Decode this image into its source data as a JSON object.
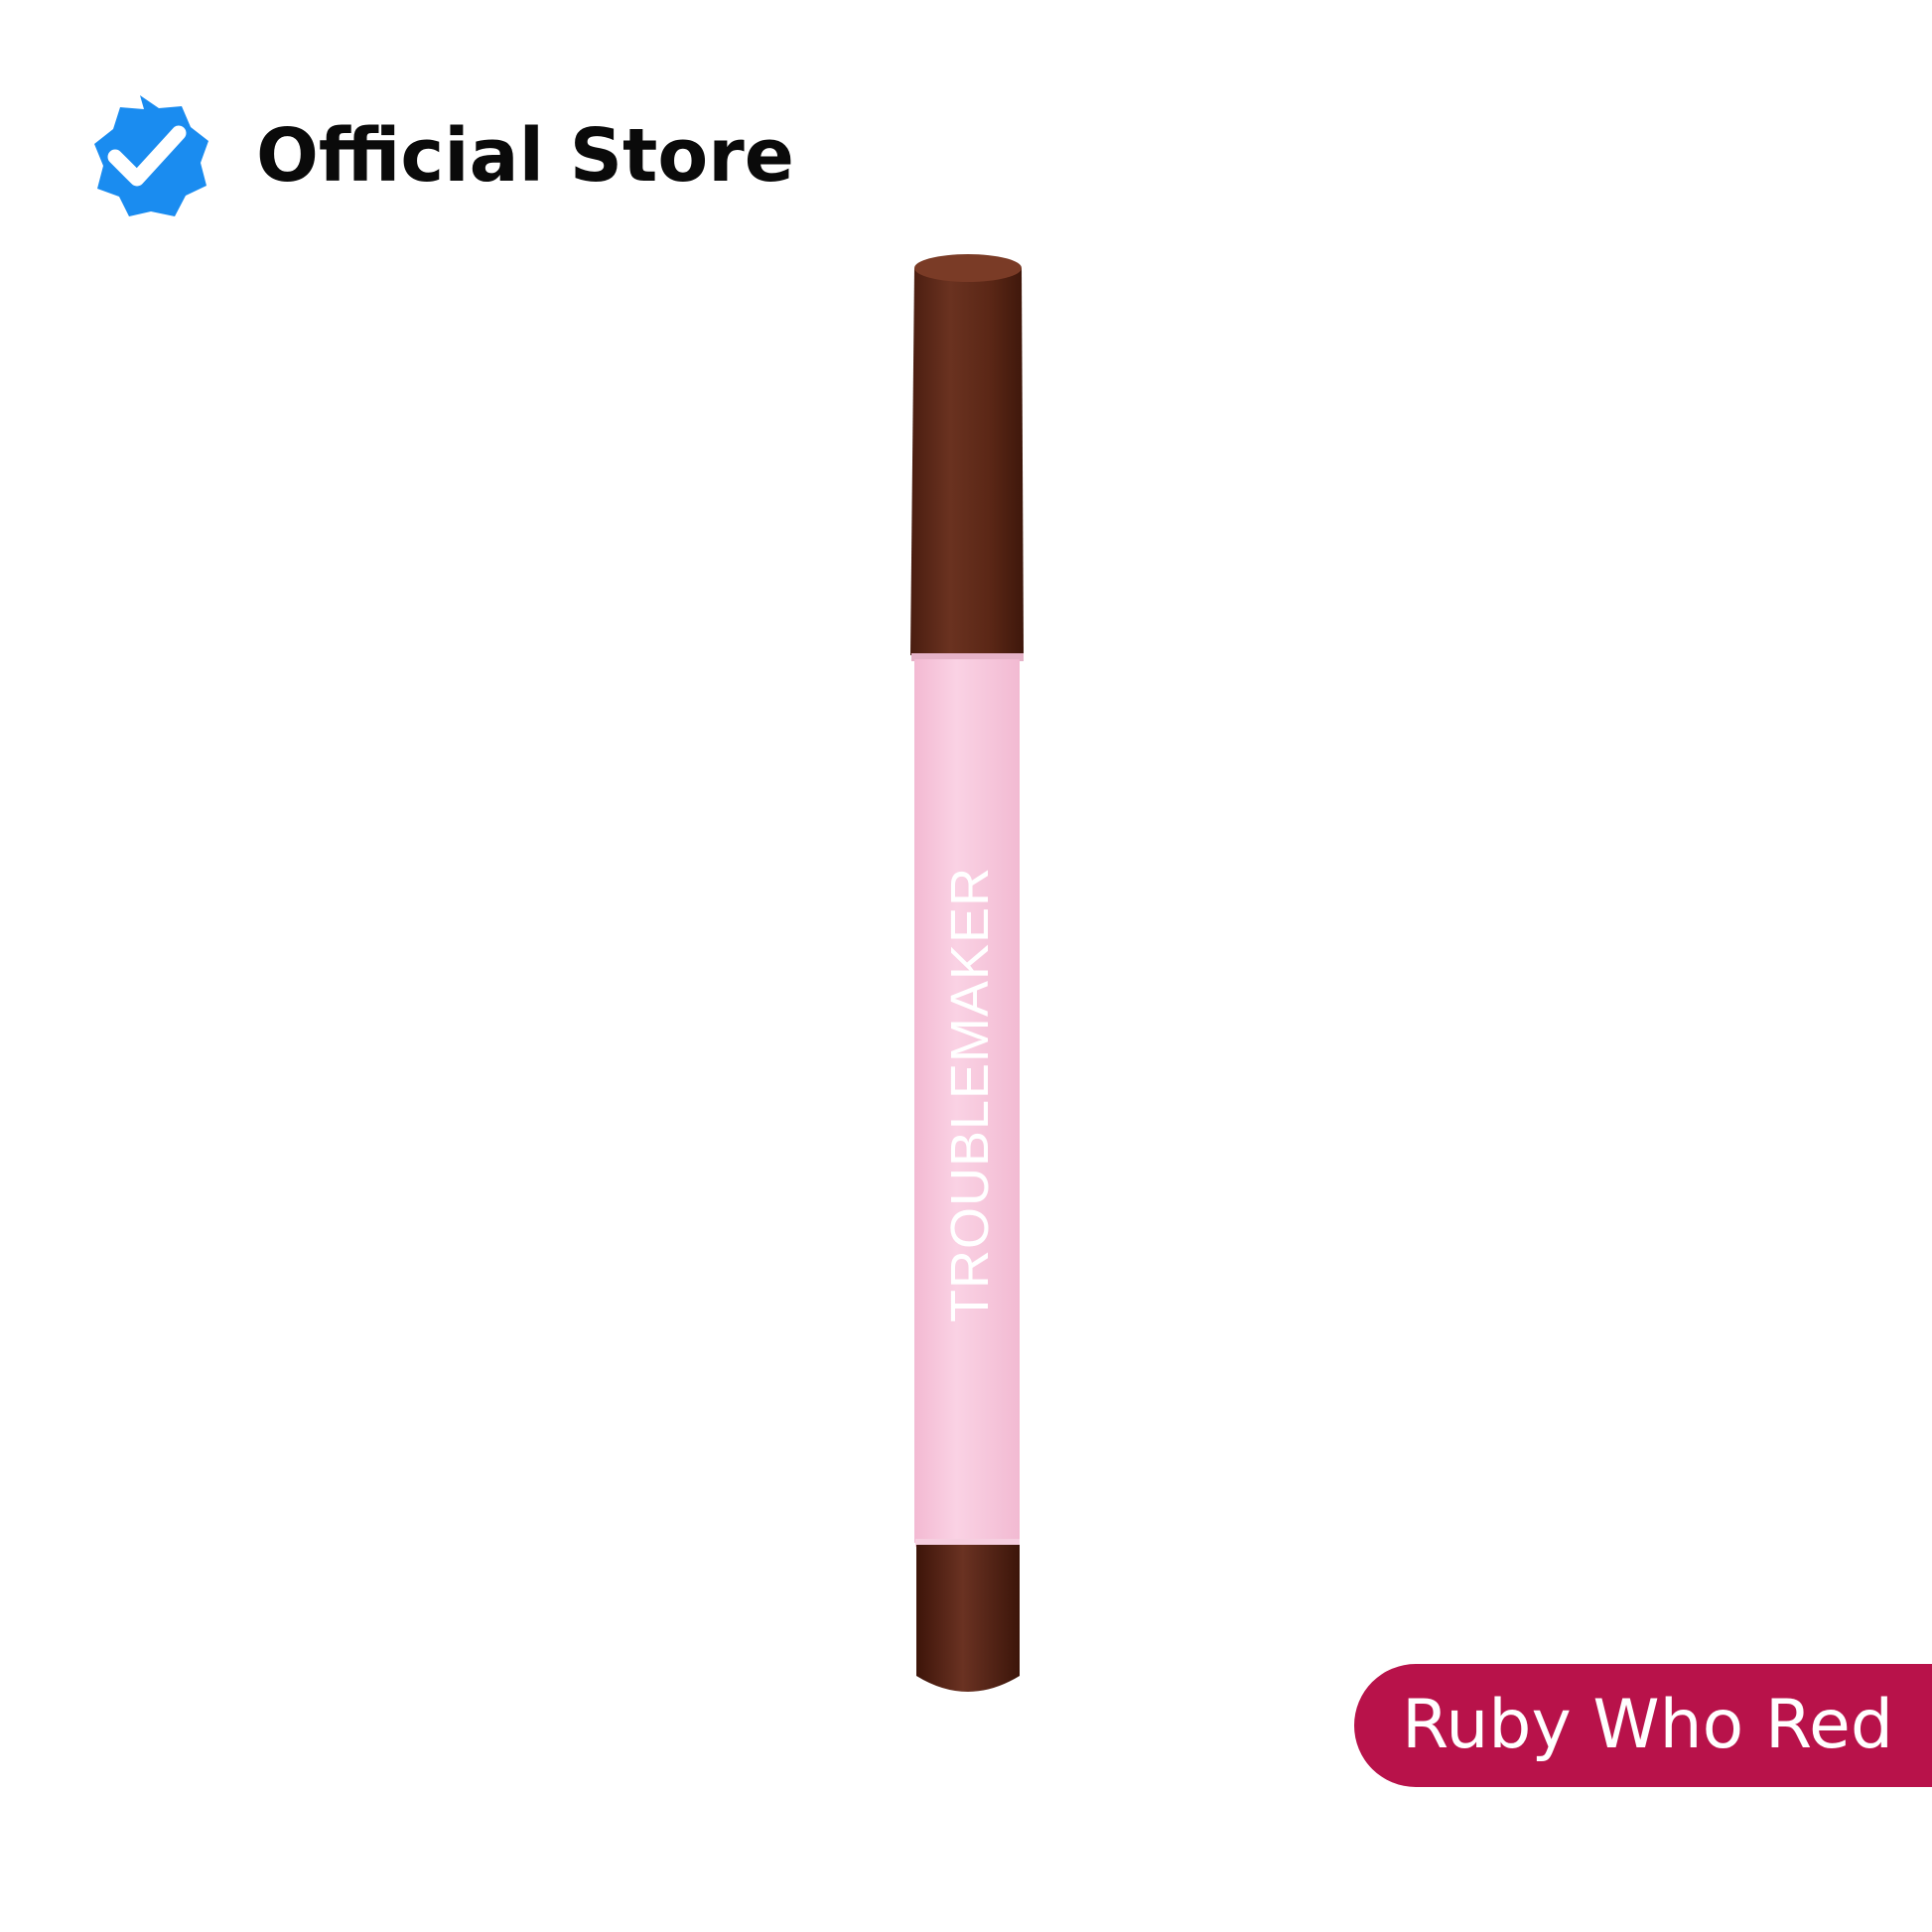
{
  "store_badge": {
    "label": "Official Store",
    "icon": "verified-check-icon",
    "icon_color": "#1a8cf0"
  },
  "product": {
    "brand": "TROUBLEMAKER",
    "cap_color": "#5b2716",
    "barrel_color": "#f8c6dd",
    "tip_color": "#5b2716"
  },
  "shade": {
    "name": "Ruby Who Red",
    "pill_color": "#b8124a"
  }
}
